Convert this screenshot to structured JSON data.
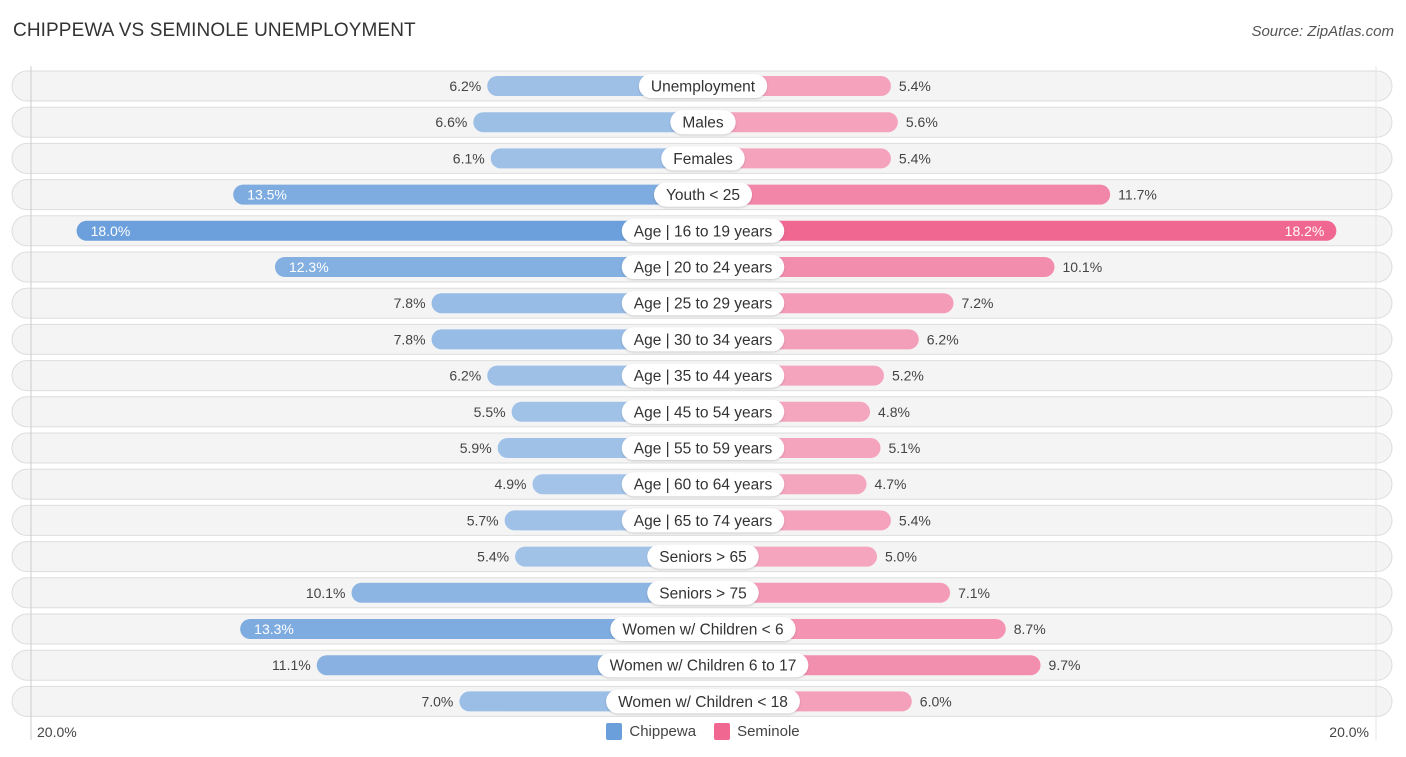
{
  "header": {
    "title": "CHIPPEWA VS SEMINOLE UNEMPLOYMENT",
    "source": "Source: ZipAtlas.com"
  },
  "colors": {
    "chippewa_strong": "#6a9fdc",
    "chippewa_light": "#a4c4e8",
    "seminole_strong": "#f06892",
    "seminole_light": "#f5a6bf"
  },
  "chart_data": {
    "type": "bar",
    "orientation": "horizontal-diverging",
    "title": "CHIPPEWA VS SEMINOLE UNEMPLOYMENT",
    "xlabel": "",
    "ylabel": "",
    "axis_min_label": "20.0%",
    "axis_max_label": "20.0%",
    "xlim": [
      -20,
      20
    ],
    "legend_position": "bottom-center",
    "categories": [
      "Unemployment",
      "Males",
      "Females",
      "Youth < 25",
      "Age | 16 to 19 years",
      "Age | 20 to 24 years",
      "Age | 25 to 29 years",
      "Age | 30 to 34 years",
      "Age | 35 to 44 years",
      "Age | 45 to 54 years",
      "Age | 55 to 59 years",
      "Age | 60 to 64 years",
      "Age | 65 to 74 years",
      "Seniors > 65",
      "Seniors > 75",
      "Women w/ Children < 6",
      "Women w/ Children 6 to 17",
      "Women w/ Children < 18"
    ],
    "series": [
      {
        "name": "Chippewa",
        "side": "left",
        "values": [
          6.2,
          6.6,
          6.1,
          13.5,
          18.0,
          12.3,
          7.8,
          7.8,
          6.2,
          5.5,
          5.9,
          4.9,
          5.7,
          5.4,
          10.1,
          13.3,
          11.1,
          7.0
        ],
        "labels": [
          "6.2%",
          "6.6%",
          "6.1%",
          "13.5%",
          "18.0%",
          "12.3%",
          "7.8%",
          "7.8%",
          "6.2%",
          "5.5%",
          "5.9%",
          "4.9%",
          "5.7%",
          "5.4%",
          "10.1%",
          "13.3%",
          "11.1%",
          "7.0%"
        ]
      },
      {
        "name": "Seminole",
        "side": "right",
        "values": [
          5.4,
          5.6,
          5.4,
          11.7,
          18.2,
          10.1,
          7.2,
          6.2,
          5.2,
          4.8,
          5.1,
          4.7,
          5.4,
          5.0,
          7.1,
          8.7,
          9.7,
          6.0
        ],
        "labels": [
          "5.4%",
          "5.6%",
          "5.4%",
          "11.7%",
          "18.2%",
          "10.1%",
          "7.2%",
          "6.2%",
          "5.2%",
          "4.8%",
          "5.1%",
          "4.7%",
          "5.4%",
          "5.0%",
          "7.1%",
          "8.7%",
          "9.7%",
          "6.0%"
        ]
      }
    ]
  },
  "legend": {
    "items": [
      {
        "label": "Chippewa",
        "color": "#6a9fdc"
      },
      {
        "label": "Seminole",
        "color": "#f06892"
      }
    ]
  }
}
